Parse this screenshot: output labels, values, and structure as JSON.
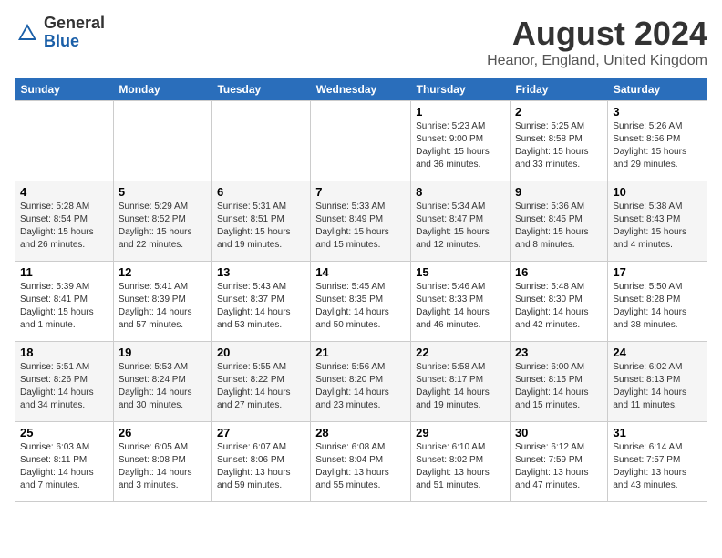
{
  "header": {
    "logo_general": "General",
    "logo_blue": "Blue",
    "month": "August 2024",
    "location": "Heanor, England, United Kingdom"
  },
  "weekdays": [
    "Sunday",
    "Monday",
    "Tuesday",
    "Wednesday",
    "Thursday",
    "Friday",
    "Saturday"
  ],
  "weeks": [
    [
      {
        "day": "",
        "info": ""
      },
      {
        "day": "",
        "info": ""
      },
      {
        "day": "",
        "info": ""
      },
      {
        "day": "",
        "info": ""
      },
      {
        "day": "1",
        "info": "Sunrise: 5:23 AM\nSunset: 9:00 PM\nDaylight: 15 hours\nand 36 minutes."
      },
      {
        "day": "2",
        "info": "Sunrise: 5:25 AM\nSunset: 8:58 PM\nDaylight: 15 hours\nand 33 minutes."
      },
      {
        "day": "3",
        "info": "Sunrise: 5:26 AM\nSunset: 8:56 PM\nDaylight: 15 hours\nand 29 minutes."
      }
    ],
    [
      {
        "day": "4",
        "info": "Sunrise: 5:28 AM\nSunset: 8:54 PM\nDaylight: 15 hours\nand 26 minutes."
      },
      {
        "day": "5",
        "info": "Sunrise: 5:29 AM\nSunset: 8:52 PM\nDaylight: 15 hours\nand 22 minutes."
      },
      {
        "day": "6",
        "info": "Sunrise: 5:31 AM\nSunset: 8:51 PM\nDaylight: 15 hours\nand 19 minutes."
      },
      {
        "day": "7",
        "info": "Sunrise: 5:33 AM\nSunset: 8:49 PM\nDaylight: 15 hours\nand 15 minutes."
      },
      {
        "day": "8",
        "info": "Sunrise: 5:34 AM\nSunset: 8:47 PM\nDaylight: 15 hours\nand 12 minutes."
      },
      {
        "day": "9",
        "info": "Sunrise: 5:36 AM\nSunset: 8:45 PM\nDaylight: 15 hours\nand 8 minutes."
      },
      {
        "day": "10",
        "info": "Sunrise: 5:38 AM\nSunset: 8:43 PM\nDaylight: 15 hours\nand 4 minutes."
      }
    ],
    [
      {
        "day": "11",
        "info": "Sunrise: 5:39 AM\nSunset: 8:41 PM\nDaylight: 15 hours\nand 1 minute."
      },
      {
        "day": "12",
        "info": "Sunrise: 5:41 AM\nSunset: 8:39 PM\nDaylight: 14 hours\nand 57 minutes."
      },
      {
        "day": "13",
        "info": "Sunrise: 5:43 AM\nSunset: 8:37 PM\nDaylight: 14 hours\nand 53 minutes."
      },
      {
        "day": "14",
        "info": "Sunrise: 5:45 AM\nSunset: 8:35 PM\nDaylight: 14 hours\nand 50 minutes."
      },
      {
        "day": "15",
        "info": "Sunrise: 5:46 AM\nSunset: 8:33 PM\nDaylight: 14 hours\nand 46 minutes."
      },
      {
        "day": "16",
        "info": "Sunrise: 5:48 AM\nSunset: 8:30 PM\nDaylight: 14 hours\nand 42 minutes."
      },
      {
        "day": "17",
        "info": "Sunrise: 5:50 AM\nSunset: 8:28 PM\nDaylight: 14 hours\nand 38 minutes."
      }
    ],
    [
      {
        "day": "18",
        "info": "Sunrise: 5:51 AM\nSunset: 8:26 PM\nDaylight: 14 hours\nand 34 minutes."
      },
      {
        "day": "19",
        "info": "Sunrise: 5:53 AM\nSunset: 8:24 PM\nDaylight: 14 hours\nand 30 minutes."
      },
      {
        "day": "20",
        "info": "Sunrise: 5:55 AM\nSunset: 8:22 PM\nDaylight: 14 hours\nand 27 minutes."
      },
      {
        "day": "21",
        "info": "Sunrise: 5:56 AM\nSunset: 8:20 PM\nDaylight: 14 hours\nand 23 minutes."
      },
      {
        "day": "22",
        "info": "Sunrise: 5:58 AM\nSunset: 8:17 PM\nDaylight: 14 hours\nand 19 minutes."
      },
      {
        "day": "23",
        "info": "Sunrise: 6:00 AM\nSunset: 8:15 PM\nDaylight: 14 hours\nand 15 minutes."
      },
      {
        "day": "24",
        "info": "Sunrise: 6:02 AM\nSunset: 8:13 PM\nDaylight: 14 hours\nand 11 minutes."
      }
    ],
    [
      {
        "day": "25",
        "info": "Sunrise: 6:03 AM\nSunset: 8:11 PM\nDaylight: 14 hours\nand 7 minutes."
      },
      {
        "day": "26",
        "info": "Sunrise: 6:05 AM\nSunset: 8:08 PM\nDaylight: 14 hours\nand 3 minutes."
      },
      {
        "day": "27",
        "info": "Sunrise: 6:07 AM\nSunset: 8:06 PM\nDaylight: 13 hours\nand 59 minutes."
      },
      {
        "day": "28",
        "info": "Sunrise: 6:08 AM\nSunset: 8:04 PM\nDaylight: 13 hours\nand 55 minutes."
      },
      {
        "day": "29",
        "info": "Sunrise: 6:10 AM\nSunset: 8:02 PM\nDaylight: 13 hours\nand 51 minutes."
      },
      {
        "day": "30",
        "info": "Sunrise: 6:12 AM\nSunset: 7:59 PM\nDaylight: 13 hours\nand 47 minutes."
      },
      {
        "day": "31",
        "info": "Sunrise: 6:14 AM\nSunset: 7:57 PM\nDaylight: 13 hours\nand 43 minutes."
      }
    ]
  ]
}
